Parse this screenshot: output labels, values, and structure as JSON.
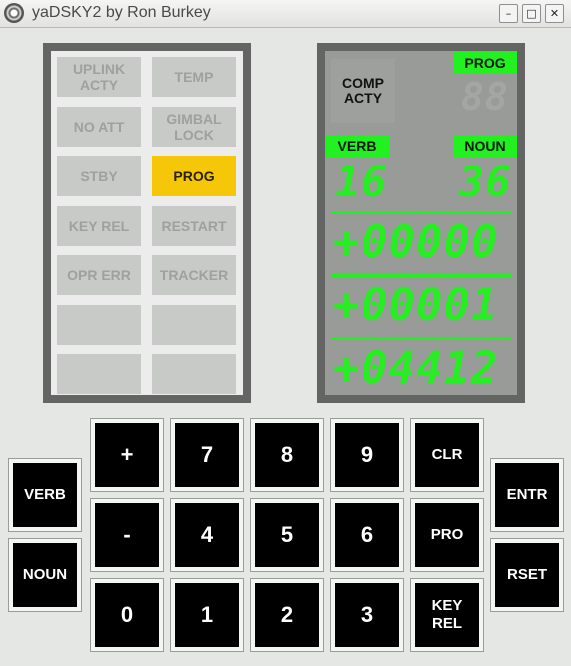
{
  "window": {
    "title": "yaDSKY2 by Ron Burkey",
    "minimize_label": "–",
    "maximize_label": "□",
    "close_label": "✕"
  },
  "annunciators": [
    {
      "label": "UPLINK\nACTY",
      "lit": false
    },
    {
      "label": "TEMP",
      "lit": false
    },
    {
      "label": "NO ATT",
      "lit": false
    },
    {
      "label": "GIMBAL\nLOCK",
      "lit": false
    },
    {
      "label": "STBY",
      "lit": false
    },
    {
      "label": "PROG",
      "lit": true
    },
    {
      "label": "KEY REL",
      "lit": false
    },
    {
      "label": "RESTART",
      "lit": false
    },
    {
      "label": "OPR ERR",
      "lit": false
    },
    {
      "label": "TRACKER",
      "lit": false
    },
    {
      "label": "",
      "lit": false
    },
    {
      "label": "",
      "lit": false
    },
    {
      "label": "",
      "lit": false
    },
    {
      "label": "",
      "lit": false
    }
  ],
  "display": {
    "comp_acty": "COMP\nACTY",
    "prog_label": "PROG",
    "prog_value": "88",
    "verb_label": "VERB",
    "verb_value": "16",
    "noun_label": "NOUN",
    "noun_value": "36",
    "registers": [
      {
        "sign": "+",
        "value": "00000"
      },
      {
        "sign": "+",
        "value": "00001"
      },
      {
        "sign": "+",
        "value": "04412"
      }
    ],
    "colors": {
      "segment_on": "#26ee22",
      "lamp_lit": "#f6c609"
    }
  },
  "keypad": {
    "verb": "VERB",
    "noun": "NOUN",
    "plus": "+",
    "minus": "-",
    "k0": "0",
    "k1": "1",
    "k2": "2",
    "k3": "3",
    "k4": "4",
    "k5": "5",
    "k6": "6",
    "k7": "7",
    "k8": "8",
    "k9": "9",
    "clr": "CLR",
    "pro": "PRO",
    "key_rel": "KEY\nREL",
    "entr": "ENTR",
    "rset": "RSET"
  }
}
